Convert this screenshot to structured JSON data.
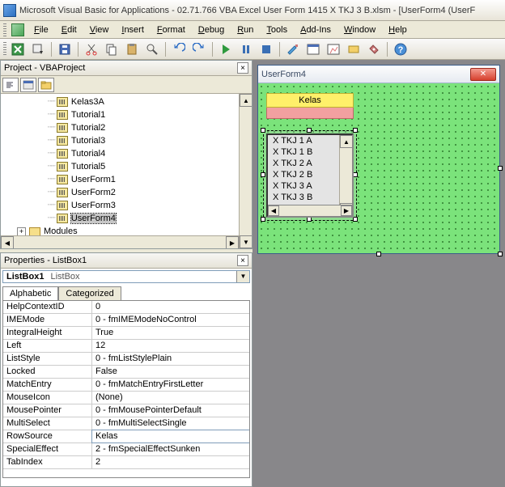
{
  "window": {
    "title": "Microsoft Visual Basic for Applications - 02.71.766 VBA Excel User Form 1415 X TKJ 3 B.xlsm - [UserForm4 (UserF"
  },
  "menu": {
    "items": [
      "File",
      "Edit",
      "View",
      "Insert",
      "Format",
      "Debug",
      "Run",
      "Tools",
      "Add-Ins",
      "Window",
      "Help"
    ]
  },
  "project_panel": {
    "title": "Project - VBAProject",
    "tree": [
      {
        "label": "Kelas3A",
        "type": "form",
        "indent": 2
      },
      {
        "label": "Tutorial1",
        "type": "form",
        "indent": 2
      },
      {
        "label": "Tutorial2",
        "type": "form",
        "indent": 2
      },
      {
        "label": "Tutorial3",
        "type": "form",
        "indent": 2
      },
      {
        "label": "Tutorial4",
        "type": "form",
        "indent": 2
      },
      {
        "label": "Tutorial5",
        "type": "form",
        "indent": 2
      },
      {
        "label": "UserForm1",
        "type": "form",
        "indent": 2
      },
      {
        "label": "UserForm2",
        "type": "form",
        "indent": 2
      },
      {
        "label": "UserForm3",
        "type": "form",
        "indent": 2
      },
      {
        "label": "UserForm4",
        "type": "form",
        "indent": 2,
        "selected": true
      },
      {
        "label": "Modules",
        "type": "folder",
        "indent": 1,
        "expander": "+"
      }
    ]
  },
  "properties_panel": {
    "title": "Properties - ListBox1",
    "object_name": "ListBox1",
    "object_type": "ListBox",
    "tabs": [
      "Alphabetic",
      "Categorized"
    ],
    "rows": [
      {
        "name": "HelpContextID",
        "value": "0"
      },
      {
        "name": "IMEMode",
        "value": "0 - fmIMEModeNoControl"
      },
      {
        "name": "IntegralHeight",
        "value": "True"
      },
      {
        "name": "Left",
        "value": "12"
      },
      {
        "name": "ListStyle",
        "value": "0 - fmListStylePlain"
      },
      {
        "name": "Locked",
        "value": "False"
      },
      {
        "name": "MatchEntry",
        "value": "0 - fmMatchEntryFirstLetter"
      },
      {
        "name": "MouseIcon",
        "value": "(None)"
      },
      {
        "name": "MousePointer",
        "value": "0 - fmMousePointerDefault"
      },
      {
        "name": "MultiSelect",
        "value": "0 - fmMultiSelectSingle"
      },
      {
        "name": "RowSource",
        "value": "Kelas",
        "selected": true
      },
      {
        "name": "SpecialEffect",
        "value": "2 - fmSpecialEffectSunken"
      },
      {
        "name": "TabIndex",
        "value": "2"
      }
    ]
  },
  "designer": {
    "form_caption": "UserForm4",
    "label_caption": "Kelas",
    "listbox_items": [
      "X TKJ 1 A",
      "X TKJ 1 B",
      "X TKJ 2 A",
      "X TKJ 2 B",
      "X TKJ 3 A",
      "X TKJ 3 B"
    ]
  }
}
